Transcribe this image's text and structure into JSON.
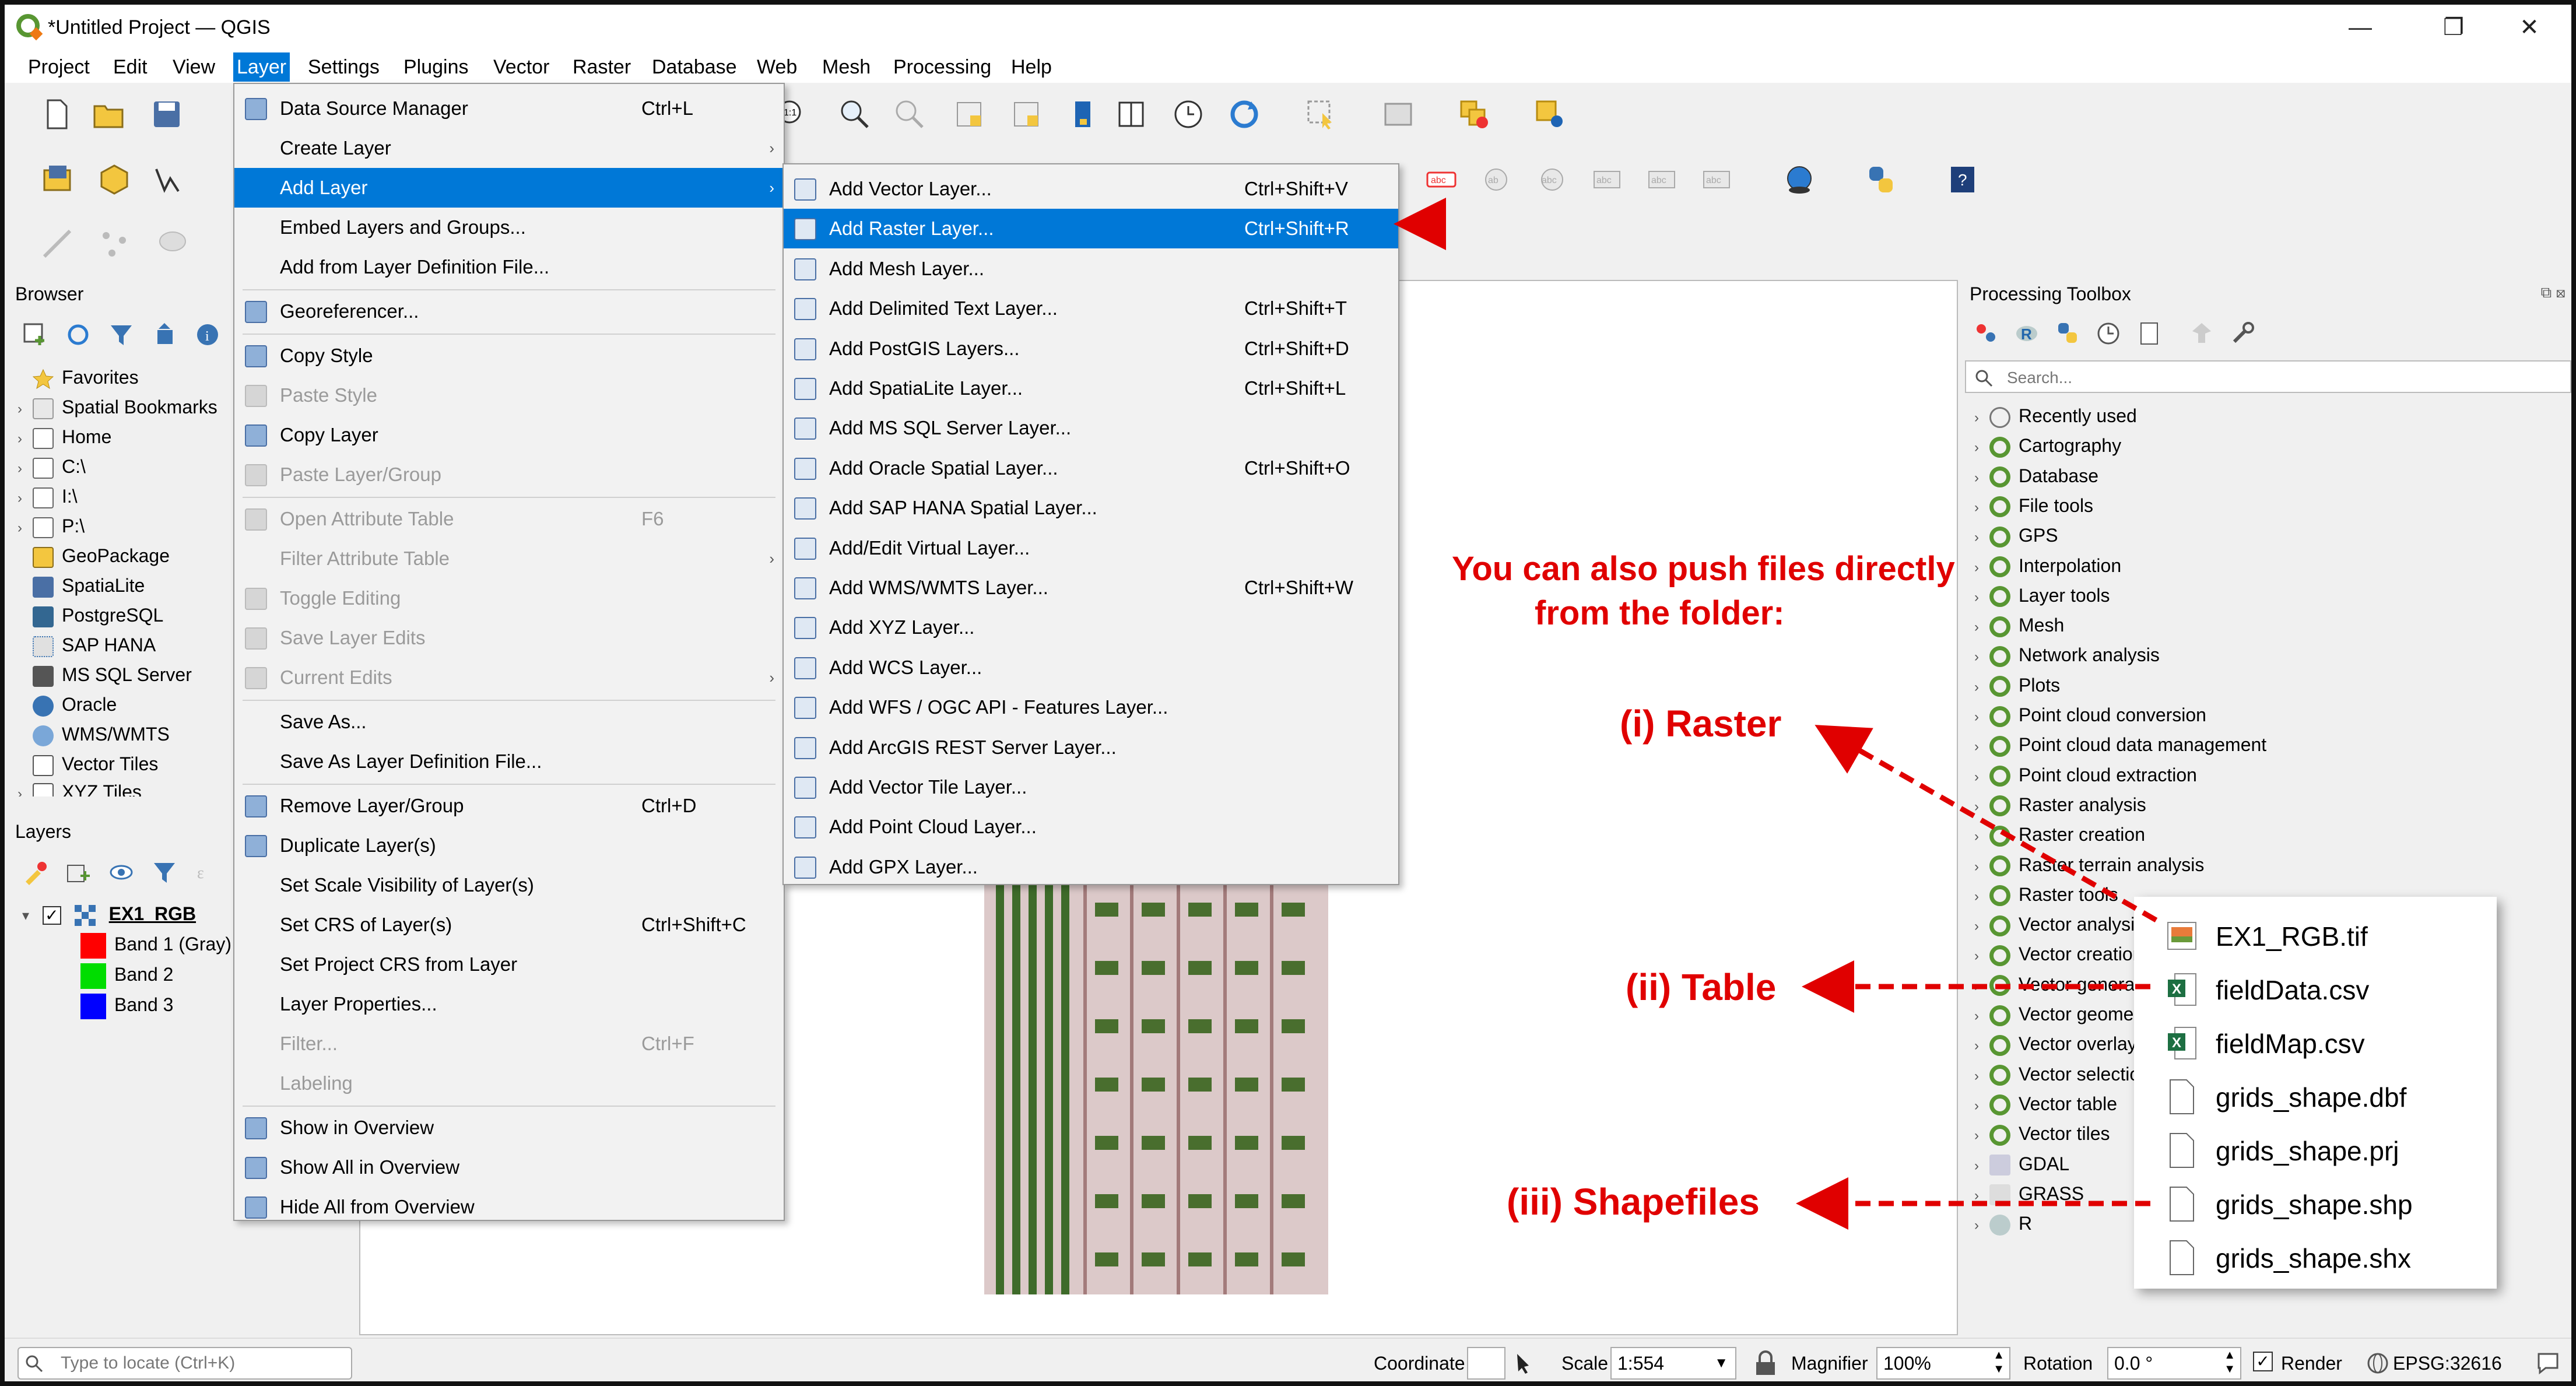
{
  "window": {
    "title": "*Untitled Project — QGIS",
    "buttons": [
      "—",
      "❐",
      "✕"
    ]
  },
  "menubar": [
    "Project",
    "Edit",
    "View",
    "Layer",
    "Settings",
    "Plugins",
    "Vector",
    "Raster",
    "Database",
    "Web",
    "Mesh",
    "Processing",
    "Help"
  ],
  "layer_menu": {
    "items": [
      {
        "label": "Data Source Manager",
        "shortcut": "Ctrl+L",
        "state": "normal",
        "icon": "data-source-manager-icon"
      },
      {
        "label": "Create Layer",
        "shortcut": "",
        "state": "normal",
        "submenu": true
      },
      {
        "label": "Add Layer",
        "shortcut": "",
        "state": "highlighted",
        "submenu": true
      },
      {
        "label": "Embed Layers and Groups...",
        "shortcut": "",
        "state": "normal"
      },
      {
        "label": "Add from Layer Definition File...",
        "shortcut": "",
        "state": "normal"
      },
      {
        "label": "Georeferencer...",
        "shortcut": "",
        "state": "normal",
        "icon": "georeferencer-icon"
      },
      {
        "label": "Copy Style",
        "shortcut": "",
        "state": "normal",
        "icon": "copy-style-icon"
      },
      {
        "label": "Paste Style",
        "shortcut": "",
        "state": "disabled",
        "icon": "paste-style-icon"
      },
      {
        "label": "Copy Layer",
        "shortcut": "",
        "state": "normal",
        "icon": "copy-layer-icon"
      },
      {
        "label": "Paste Layer/Group",
        "shortcut": "",
        "state": "disabled",
        "icon": "paste-layer-icon"
      },
      {
        "label": "Open Attribute Table",
        "shortcut": "F6",
        "state": "disabled",
        "icon": "attribute-table-icon"
      },
      {
        "label": "Filter Attribute Table",
        "shortcut": "",
        "state": "disabled",
        "submenu": true
      },
      {
        "label": "Toggle Editing",
        "shortcut": "",
        "state": "disabled",
        "icon": "toggle-editing-icon"
      },
      {
        "label": "Save Layer Edits",
        "shortcut": "",
        "state": "disabled",
        "icon": "save-edits-icon"
      },
      {
        "label": "Current Edits",
        "shortcut": "",
        "state": "disabled",
        "icon": "current-edits-icon",
        "submenu": true
      },
      {
        "label": "Save As...",
        "shortcut": "",
        "state": "normal"
      },
      {
        "label": "Save As Layer Definition File...",
        "shortcut": "",
        "state": "normal"
      },
      {
        "label": "Remove Layer/Group",
        "shortcut": "Ctrl+D",
        "state": "normal",
        "icon": "remove-layer-icon"
      },
      {
        "label": "Duplicate Layer(s)",
        "shortcut": "",
        "state": "normal",
        "icon": "duplicate-layer-icon"
      },
      {
        "label": "Set Scale Visibility of Layer(s)",
        "shortcut": "",
        "state": "normal"
      },
      {
        "label": "Set CRS of Layer(s)",
        "shortcut": "Ctrl+Shift+C",
        "state": "normal"
      },
      {
        "label": "Set Project CRS from Layer",
        "shortcut": "",
        "state": "normal"
      },
      {
        "label": "Layer Properties...",
        "shortcut": "",
        "state": "normal"
      },
      {
        "label": "Filter...",
        "shortcut": "Ctrl+F",
        "state": "disabled"
      },
      {
        "label": "Labeling",
        "shortcut": "",
        "state": "disabled"
      },
      {
        "label": "Show in Overview",
        "shortcut": "",
        "state": "normal",
        "icon": "show-overview-icon"
      },
      {
        "label": "Show All in Overview",
        "shortcut": "",
        "state": "normal",
        "icon": "show-all-overview-icon"
      },
      {
        "label": "Hide All from Overview",
        "shortcut": "",
        "state": "normal",
        "icon": "hide-overview-icon"
      }
    ]
  },
  "add_layer_menu": {
    "items": [
      {
        "label": "Add Vector Layer...",
        "shortcut": "Ctrl+Shift+V",
        "icon": "vector-layer-icon"
      },
      {
        "label": "Add Raster Layer...",
        "shortcut": "Ctrl+Shift+R",
        "icon": "raster-layer-icon",
        "highlighted": true
      },
      {
        "label": "Add Mesh Layer...",
        "shortcut": "",
        "icon": "mesh-layer-icon"
      },
      {
        "label": "Add Delimited Text Layer...",
        "shortcut": "Ctrl+Shift+T",
        "icon": "delimited-text-icon"
      },
      {
        "label": "Add PostGIS Layers...",
        "shortcut": "Ctrl+Shift+D",
        "icon": "postgis-icon"
      },
      {
        "label": "Add SpatiaLite Layer...",
        "shortcut": "Ctrl+Shift+L",
        "icon": "spatialite-icon"
      },
      {
        "label": "Add MS SQL Server Layer...",
        "shortcut": "",
        "icon": "mssql-icon"
      },
      {
        "label": "Add Oracle Spatial Layer...",
        "shortcut": "Ctrl+Shift+O",
        "icon": "oracle-icon"
      },
      {
        "label": "Add SAP HANA Spatial Layer...",
        "shortcut": "",
        "icon": "sap-hana-icon"
      },
      {
        "label": "Add/Edit Virtual Layer...",
        "shortcut": "",
        "icon": "virtual-layer-icon"
      },
      {
        "label": "Add WMS/WMTS Layer...",
        "shortcut": "Ctrl+Shift+W",
        "icon": "wms-icon"
      },
      {
        "label": "Add XYZ Layer...",
        "shortcut": "",
        "icon": "xyz-icon"
      },
      {
        "label": "Add WCS Layer...",
        "shortcut": "",
        "icon": "wcs-icon"
      },
      {
        "label": "Add WFS / OGC API - Features Layer...",
        "shortcut": "",
        "icon": "wfs-icon"
      },
      {
        "label": "Add ArcGIS REST Server Layer...",
        "shortcut": "",
        "icon": "arcgis-rest-icon"
      },
      {
        "label": "Add Vector Tile Layer...",
        "shortcut": "",
        "icon": "vector-tile-icon"
      },
      {
        "label": "Add Point Cloud Layer...",
        "shortcut": "",
        "icon": "point-cloud-icon"
      },
      {
        "label": "Add GPX Layer...",
        "shortcut": "",
        "icon": "gpx-icon"
      }
    ]
  },
  "browser": {
    "title": "Browser",
    "items": [
      "Favorites",
      "Spatial Bookmarks",
      "Home",
      "C:\\",
      "I:\\",
      "P:\\",
      "GeoPackage",
      "SpatiaLite",
      "PostgreSQL",
      "SAP HANA",
      "MS SQL Server",
      "Oracle",
      "WMS/WMTS",
      "Vector Tiles",
      "XYZ Tiles"
    ]
  },
  "layers": {
    "title": "Layers",
    "layer_name": "EX1_RGB",
    "bands": [
      {
        "label": "Band 1 (Gray)",
        "color": "#ff0000"
      },
      {
        "label": "Band 2",
        "color": "#00dd00"
      },
      {
        "label": "Band 3",
        "color": "#0000ff"
      }
    ]
  },
  "processing": {
    "title": "Processing Toolbox",
    "search_placeholder": "Search...",
    "items": [
      "Recently used",
      "Cartography",
      "Database",
      "File tools",
      "GPS",
      "Interpolation",
      "Layer tools",
      "Mesh",
      "Network analysis",
      "Plots",
      "Point cloud conversion",
      "Point cloud data management",
      "Point cloud extraction",
      "Raster analysis",
      "Raster creation",
      "Raster terrain analysis",
      "Raster tools",
      "Vector analysis",
      "Vector creation",
      "Vector general",
      "Vector geometry",
      "Vector overlay",
      "Vector selection",
      "Vector table",
      "Vector tiles",
      "GDAL",
      "GRASS",
      "R"
    ]
  },
  "annotations": {
    "headline_1": "You can also push files directly",
    "headline_2": "from the folder:",
    "raster": "(i) Raster",
    "table": "(ii) Table",
    "shapefiles": "(iii) Shapefiles"
  },
  "files": [
    "EX1_RGB.tif",
    "fieldData.csv",
    "fieldMap.csv",
    "grids_shape.dbf",
    "grids_shape.prj",
    "grids_shape.shp",
    "grids_shape.shx"
  ],
  "statusbar": {
    "locate_placeholder": "Type to locate (Ctrl+K)",
    "coordinate_label": "Coordinate",
    "scale_label": "Scale",
    "scale_value": "1:554",
    "magnifier_label": "Magnifier",
    "magnifier_value": "100%",
    "rotation_label": "Rotation",
    "rotation_value": "0.0 °",
    "render_label": "Render",
    "crs": "EPSG:32616"
  },
  "colors": {
    "highlight": "#0078d7",
    "annotation": "#e00000",
    "qgis_green": "#589632"
  }
}
